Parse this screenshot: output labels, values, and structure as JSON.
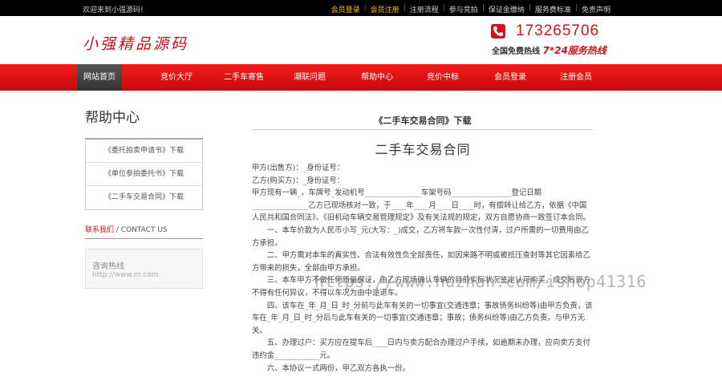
{
  "topbar": {
    "welcome": "欢迎来到小强源码!",
    "links": [
      {
        "label": "会员登录",
        "highlight": true
      },
      {
        "label": "会员注册",
        "highlight": true
      },
      {
        "label": "注册流程",
        "highlight": false
      },
      {
        "label": "参与竞拍",
        "highlight": false
      },
      {
        "label": "保证金缴纳",
        "highlight": false
      },
      {
        "label": "服务费标准",
        "highlight": false
      },
      {
        "label": "免责声明",
        "highlight": false
      }
    ]
  },
  "header": {
    "logo": "小强精品源码",
    "phone": "173265706",
    "hotline_prefix": "全国免费热线",
    "hotline_suffix": "7*24服务热线"
  },
  "nav": {
    "items": [
      "网站首页",
      "竞价大厅",
      "二手车寄售",
      "潮联问题",
      "帮助中心",
      "竞价中标",
      "会员登录",
      "注册会员"
    ],
    "active_index": 0
  },
  "sidebar": {
    "title": "帮助中心",
    "items": [
      "《委托拍卖申请书》下载",
      "《单位参拍委托书》下载",
      "《二手车交易合同》下载"
    ],
    "contact_red": "联系我们",
    "contact_sep": " / ",
    "contact_en": "CONTACT US",
    "contact_label": "咨询热线",
    "contact_url": "http://www.m.com"
  },
  "content": {
    "doc_title": "《二手车交易合同》下载",
    "contract_title": "二手车交易合同",
    "paragraphs": [
      {
        "text": "甲方(出售方)：_身份证号：",
        "indent": false
      },
      {
        "text": "乙方(购买方)：_身份证号：",
        "indent": false
      },
      {
        "text": "甲方现有一辆_，车牌号_发动机号_______________车架号码________________登记日期_______________乙方已现场核对一致，于____年____月____日____时，有偿转让给乙方，依据《中国人民共和国合同法》、《旧机动车辆交易管理规定》及有关法规的规定，双方自愿协商一致签订本合同。",
        "indent": false
      },
      {
        "text": "一、本车价款为人民币小写_元(大写：_)成交，乙方将车款一次性付清，过户所需的一切费用由乙方承担。",
        "indent": true
      },
      {
        "text": "二、甲方需对本车的真实性、合法有效性负全部责任，如因来路不明或被抵压查封等其它因素给乙方带来的损失，全部由甲方承担。",
        "indent": true
      },
      {
        "text": "三、本车甲方不做任何质量保证，由乙方现场确认车辆的目前实际状况鉴定认可购买，成交后双方不得有任何异议，不得以车况为由中途退车。",
        "indent": true
      },
      {
        "text": "四、该车在_年_月_日_时_分前与此车有关的一切事宜(交通违章；事故债务纠纷等)由甲方负责，该车在_年_月_日_时_分后与此车有关的一切事宜(交通违章；事故；债务纠纷等)由乙方负责，与甲方无关。",
        "indent": true
      },
      {
        "text": "五、办理过户：买方应在提车后____日内与卖方配合办理过户手续，如逾期未办理，应向卖方支付违约金____________元。",
        "indent": true
      },
      {
        "text": "六、本协议一式两份，甲乙双方各执一份。",
        "indent": true
      }
    ]
  },
  "watermark": "https://www.huzhan.com/ishop41316",
  "colors": {
    "brand_red": "#d4111b",
    "nav_red": "#e01414",
    "topbar_bg": "#000000",
    "highlight_yellow": "#f5c400"
  }
}
